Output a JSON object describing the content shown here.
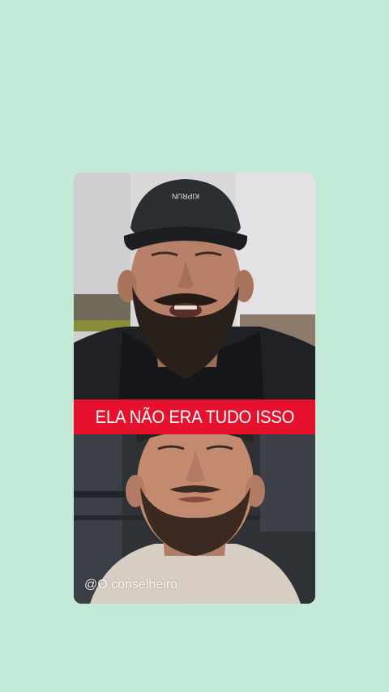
{
  "video": {
    "caption": "ELA NÃO ERA TUDO ISSO",
    "watermark": "@O conselheiro",
    "cap_logo_text": "KIPRUN"
  },
  "colors": {
    "background": "#c3ead6",
    "caption_bar": "#e8112d",
    "caption_text": "#ffffff"
  }
}
